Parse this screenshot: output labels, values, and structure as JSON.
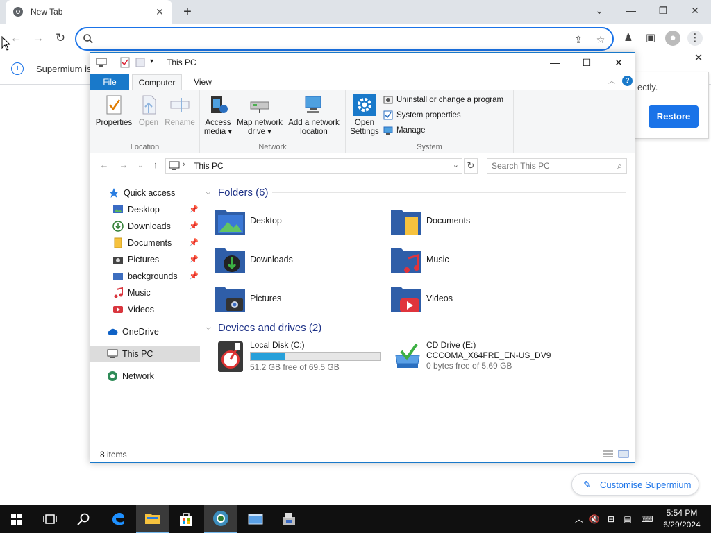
{
  "browser": {
    "tab_title": "New Tab",
    "omnibox_value": "",
    "infobar_message": "Supermium is",
    "infobar_continued": "ectly.",
    "restore_label": "Restore",
    "customise_label": "Customise Supermium"
  },
  "explorer": {
    "window_title": "This PC",
    "ribbon_tabs": [
      "File",
      "Computer",
      "View"
    ],
    "ribbon": {
      "location": {
        "label": "Location",
        "buttons": [
          "Properties",
          "Open",
          "Rename"
        ]
      },
      "network": {
        "label": "Network",
        "access_media": [
          "Access",
          "media"
        ],
        "map_drive": [
          "Map network",
          "drive"
        ],
        "add_location": [
          "Add a network",
          "location"
        ]
      },
      "system": {
        "label": "System",
        "open_settings": [
          "Open",
          "Settings"
        ],
        "items": [
          "Uninstall or change a program",
          "System properties",
          "Manage"
        ]
      }
    },
    "address_path": "This PC",
    "search_placeholder": "Search This PC",
    "nav": {
      "quick_access": "Quick access",
      "quick_items": [
        "Desktop",
        "Downloads",
        "Documents",
        "Pictures",
        "backgrounds",
        "Music",
        "Videos"
      ],
      "onedrive": "OneDrive",
      "this_pc": "This PC",
      "network": "Network"
    },
    "folders_header": "Folders (6)",
    "folders": [
      "Desktop",
      "Documents",
      "Downloads",
      "Music",
      "Pictures",
      "Videos"
    ],
    "devices_header": "Devices and drives (2)",
    "drives": [
      {
        "name": "Local Disk (C:)",
        "free": "51.2 GB free of 69.5 GB",
        "used_fraction": 0.26
      },
      {
        "name": "CD Drive (E:)",
        "label": "CCCOMA_X64FRE_EN-US_DV9",
        "free": "0 bytes free of 5.69 GB"
      }
    ],
    "status_count": "8 items"
  },
  "taskbar": {
    "time": "5:54 PM",
    "date": "6/29/2024"
  },
  "colors": {
    "accent": "#1979ca",
    "browser_blue": "#1a73e8",
    "folder_blue": "#3d6ebf",
    "taskbar": "#101010"
  }
}
